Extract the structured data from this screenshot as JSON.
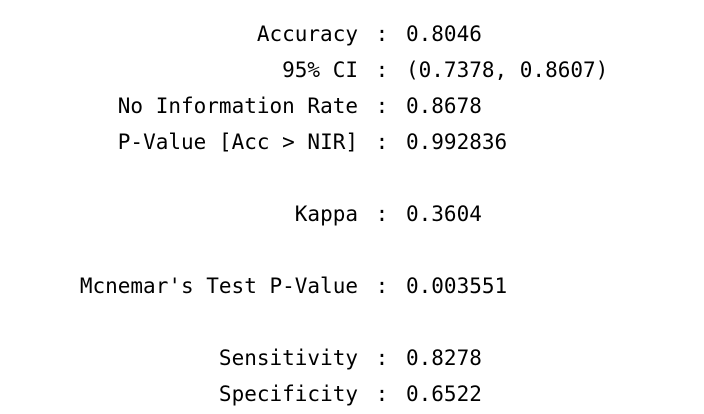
{
  "stats": [
    {
      "label": "Accuracy",
      "value": "0.8046"
    },
    {
      "label": "95% CI",
      "value": "(0.7378, 0.8607)"
    },
    {
      "label": "No Information Rate",
      "value": "0.8678"
    },
    {
      "label": "P-Value [Acc > NIR]",
      "value": "0.992836"
    },
    {
      "label": "Kappa",
      "value": "0.3604"
    },
    {
      "label": "Mcnemar's Test P-Value",
      "value": "0.003551"
    },
    {
      "label": "Sensitivity",
      "value": "0.8278"
    },
    {
      "label": "Specificity",
      "value": "0.6522"
    }
  ],
  "separator": ":"
}
